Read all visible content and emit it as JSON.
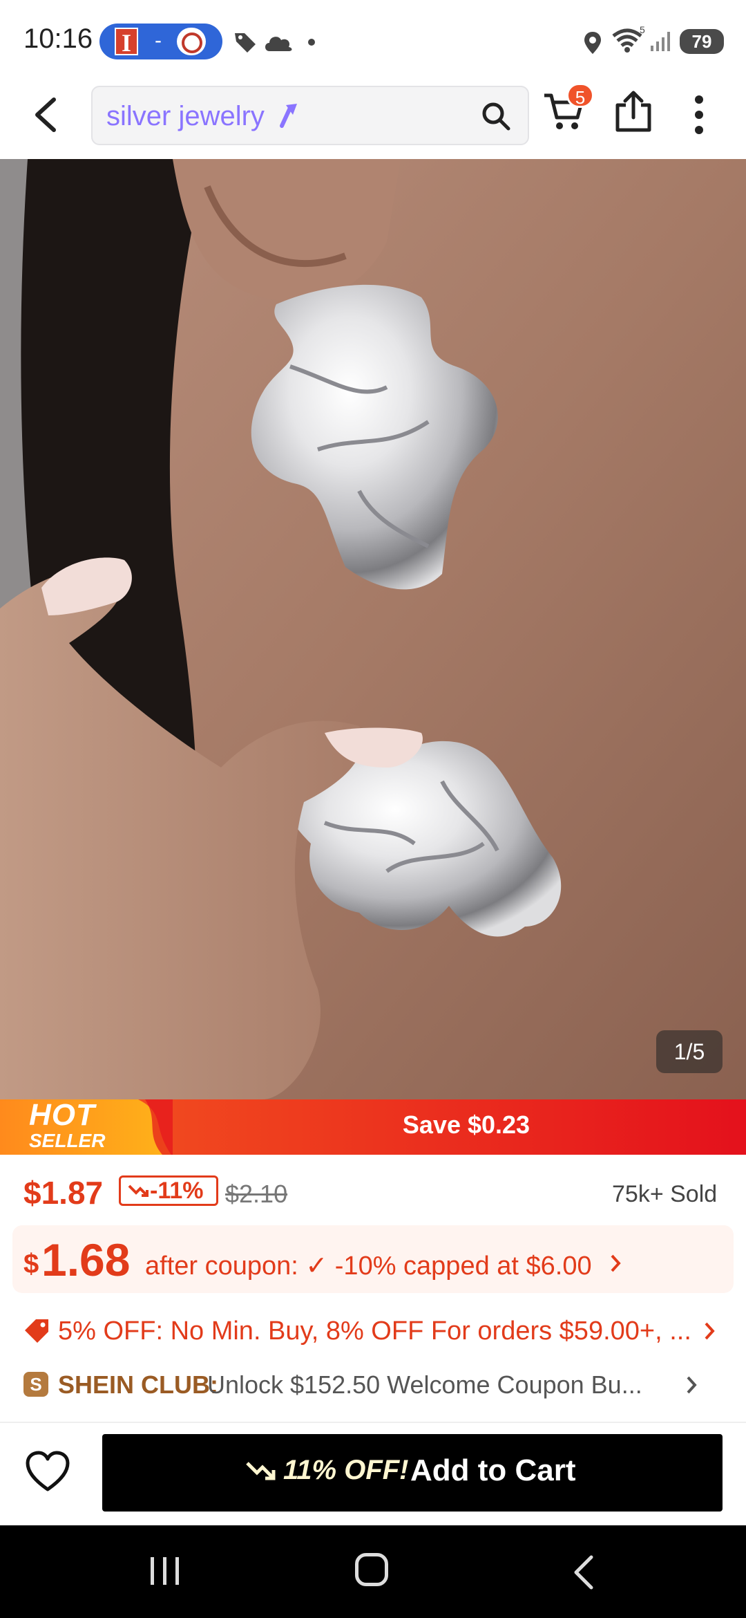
{
  "status_bar": {
    "time": "10:16",
    "pill_dash": "-",
    "battery": "79"
  },
  "search": {
    "query": "silver jewelry"
  },
  "cart": {
    "badge_count": "5"
  },
  "image": {
    "counter": "1/5"
  },
  "promo_banner": {
    "hot": "HOT",
    "seller": "SELLER",
    "save_text": "Save $0.23"
  },
  "pricing": {
    "price": "$1.87",
    "discount": "-11%",
    "original_price": "$2.10",
    "sold": "75k+ Sold"
  },
  "coupon": {
    "currency": "$",
    "price": "1.68",
    "text": "after coupon: ✓ -10% capped at $6.00"
  },
  "offer": {
    "text": "5% OFF: No Min. Buy,  8% OFF For orders $59.00+,  ..."
  },
  "club": {
    "icon_letter": "S",
    "name": "SHEIN CLUB:",
    "text": "Unlock $152.50 Welcome Coupon Bu..."
  },
  "add_to_cart": {
    "off_label": "11% OFF!",
    "label": "Add to Cart"
  },
  "colors": {
    "accent_red": "#e23b1a",
    "search_text": "#8a74ff",
    "badge": "#f0532a",
    "club_gold": "#9a5b24"
  }
}
